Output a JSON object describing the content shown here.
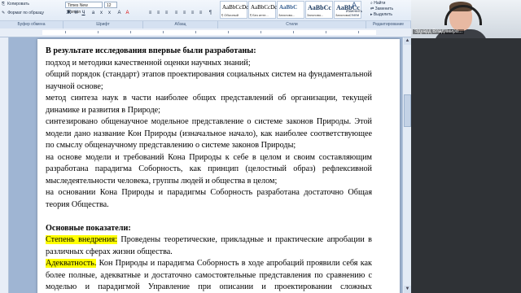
{
  "ribbon": {
    "clipboard_copy": "Копировать",
    "clipboard_format": "Формат по образцу",
    "font_name": "Times New Roman",
    "font_size": "12",
    "groups": [
      "Буфер обмена",
      "Шрифт",
      "Абзац",
      "Стили",
      "Редактирование"
    ],
    "styles": [
      {
        "preview": "AaBbCcDc",
        "name": "¶ Обычный"
      },
      {
        "preview": "AaBbCcDc",
        "name": "¶ Без инте..."
      },
      {
        "preview": "AaBbC",
        "name": "Заголово..."
      },
      {
        "preview": "AaBbCc",
        "name": "Заголово..."
      },
      {
        "preview": "AaBbCc",
        "name": "Заголово..."
      }
    ],
    "change_styles": "Изменить стили",
    "edit_find": "Найти",
    "edit_replace": "Заменить",
    "edit_select": "Выделить"
  },
  "participant": {
    "name": "Эдуард Владимиро..."
  },
  "document": {
    "heading1": "В результате исследования впервые были разработаны:",
    "para1": "подход и методики качественной оценки научных знаний;",
    "para2": "общий порядок (стандарт) этапов проектирования социальных систем на фундаментальной научной основе;",
    "para3": "метод синтеза наук в части наиболее общих представлений об организации, текущей динамике и развития в Природе;",
    "para4": "синтезировано общенаучное модельное представление о системе законов Природы. Этой модели дано название Кон Природы (изначальное начало), как наиболее соответствующее по смыслу общенаучному представлению о системе законов Природы;",
    "para5": "на основе модели и требований Кона Природы к себе в целом и своим составляющим разработана парадигма Соборность, как принцип (целостный образ) рефлексивной мыследеятельности человека, группы людей и общества в целом;",
    "para6": "на основании Кона Природы и парадигмы Соборность разработана достаточно Общая теория Общества.",
    "heading2": "Основные показатели:",
    "label1": "Степень внедрения:",
    "text1": " Проведены теоретические, прикладные и практические апробации в различных сферах жизни общества.",
    "label2": "Адекватность.",
    "text2": " Кон Природы и парадигма Соборность в ходе апробаций проявили себя как более полные, адекватные и достаточно самостоятельные представления по сравнению с моделью и парадигмой Управление при описании и проектировании сложных динамических социальных систем, которые находятся в постоянно изменяющихся"
  },
  "highlight_color": "#ffff00"
}
